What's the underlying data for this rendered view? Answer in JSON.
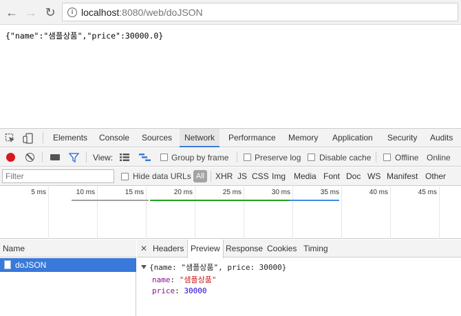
{
  "browser": {
    "url_host": "localhost",
    "url_rest": ":8080/web/doJSON"
  },
  "page": {
    "body_text": "{\"name\":\"샘플상품\",\"price\":30000.0}"
  },
  "devtools": {
    "tabs": [
      "Elements",
      "Console",
      "Sources",
      "Network",
      "Performance",
      "Memory",
      "Application",
      "Security",
      "Audits"
    ],
    "active_tab": "Network",
    "toolbar": {
      "view_label": "View:",
      "group_by_frame": "Group by frame",
      "preserve_log": "Preserve log",
      "disable_cache": "Disable cache",
      "offline": "Offline",
      "online": "Online"
    },
    "filter_bar": {
      "filter_placeholder": "Filter",
      "hide_data_urls": "Hide data URLs",
      "all": "All",
      "types": [
        "XHR",
        "JS",
        "CSS",
        "Img",
        "Media",
        "Font",
        "Doc",
        "WS",
        "Manifest",
        "Other"
      ]
    },
    "timeline_ticks": [
      "5 ms",
      "10 ms",
      "15 ms",
      "20 ms",
      "25 ms",
      "30 ms",
      "35 ms",
      "40 ms",
      "45 ms"
    ],
    "colors": {
      "record": "#d7191e",
      "accent": "#3879d9",
      "timeline_green": "#1da21d",
      "timeline_blue": "#3d8ce4",
      "timeline_gray": "#a0a0a0"
    },
    "requests_header": "Name",
    "requests": [
      {
        "name": "doJSON"
      }
    ],
    "detail_tabs": [
      "Headers",
      "Preview",
      "Response",
      "Cookies",
      "Timing"
    ],
    "active_detail_tab": "Preview",
    "preview": {
      "summary": "{name: \"샘플상품\", price: 30000}",
      "name_key": "name",
      "name_value": "\"샘플상품\"",
      "price_key": "price",
      "price_value": "30000"
    }
  }
}
